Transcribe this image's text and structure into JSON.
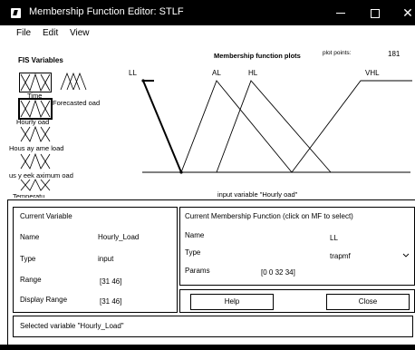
{
  "window": {
    "title": "Membership Function Editor: STLF",
    "minimize": "—",
    "maximize": "☐",
    "close": "✕"
  },
  "menu": {
    "file": "File",
    "edit": "Edit",
    "view": "View"
  },
  "fis_variables": {
    "title": "FIS Variables",
    "items": [
      {
        "label": "Time"
      },
      {
        "label": "Forecasted oad"
      },
      {
        "label": "Hourly oad"
      },
      {
        "label": "Hous ay ame load"
      },
      {
        "label": "us y eek aximum oad"
      },
      {
        "label": "Temperatu"
      }
    ]
  },
  "plot": {
    "title": "Membership function plots",
    "points_label": "plot points:",
    "points_value": "181",
    "mf_labels": [
      "LL",
      "AL",
      "HL",
      "VHL"
    ]
  },
  "input_variable_caption": "input variable \"Hourly oad\"",
  "current_variable": {
    "heading": "Current Variable",
    "name_label": "Name",
    "name_value": "Hourly_Load",
    "type_label": "Type",
    "type_value": "input",
    "range_label": "Range",
    "range_value": "[31 46]",
    "display_range_label": "Display Range",
    "display_range_value": "[31 46]"
  },
  "current_mf": {
    "heading": "Current Membership Function (click on MF to select)",
    "name_label": "Name",
    "name_value": "LL",
    "type_label": "Type",
    "type_value": "trapmf",
    "params_label": "Params",
    "params_value": "[0 0 32 34]"
  },
  "buttons": {
    "help": "Help",
    "close": "Close"
  },
  "status": "Selected variable \"Hourly_Load\""
}
